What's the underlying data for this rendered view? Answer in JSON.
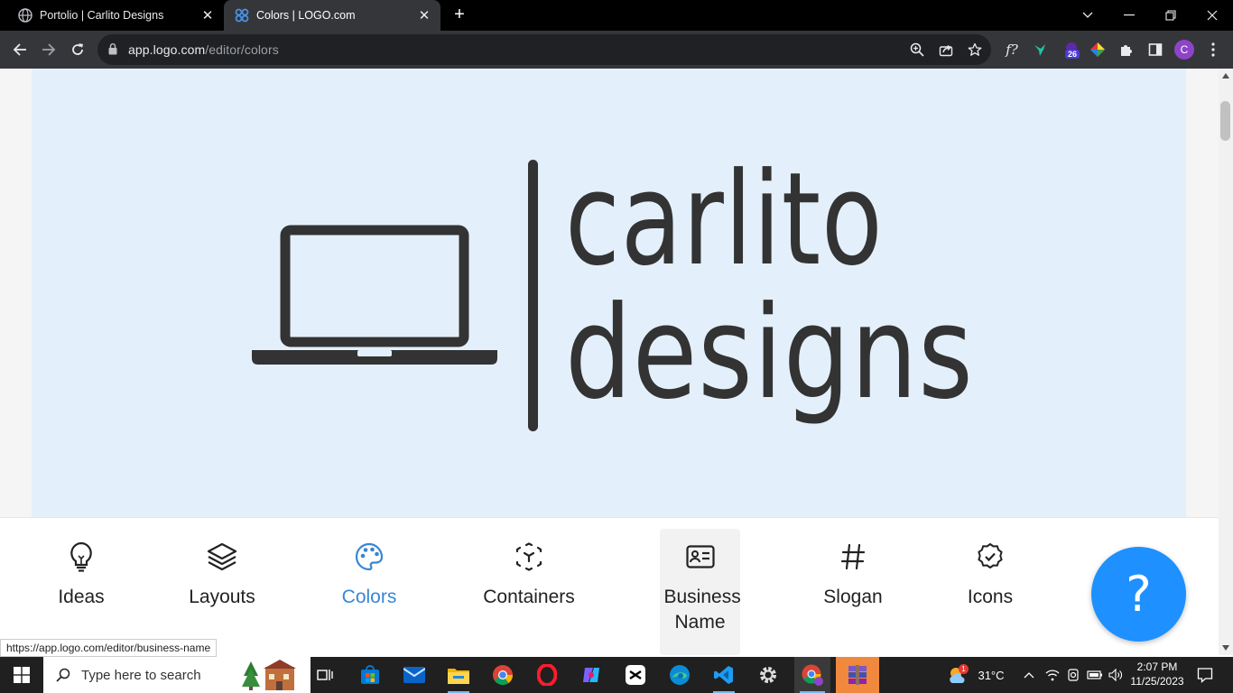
{
  "browser": {
    "tabs": [
      {
        "title": "Portolio | Carlito Designs"
      },
      {
        "title": "Colors | LOGO.com"
      }
    ],
    "url_host": "app.logo.com",
    "url_path": "/editor/colors"
  },
  "logo": {
    "line1": "carlito",
    "line2": "designs",
    "text_color": "#333333",
    "background": "#e3f0fb",
    "icon": "laptop-icon"
  },
  "tools": [
    {
      "label": "Ideas",
      "icon": "lightbulb-icon"
    },
    {
      "label": "Layouts",
      "icon": "layers-icon"
    },
    {
      "label": "Colors",
      "icon": "palette-icon",
      "active": true
    },
    {
      "label": "Containers",
      "icon": "container-icon"
    },
    {
      "label": "Business Name",
      "icon": "id-card-icon"
    },
    {
      "label": "Slogan",
      "icon": "hash-icon"
    },
    {
      "label": "Icons",
      "icon": "badge-check-icon"
    }
  ],
  "help_label": "?",
  "status_url": "https://app.logo.com/editor/business-name",
  "taskbar": {
    "search_placeholder": "Type here to search",
    "weather": "31°C",
    "weather_badge": "1",
    "time": "2:07 PM",
    "date": "11/25/2023"
  },
  "extensions": {
    "badge": "26",
    "profile": "C",
    "formula_icon": "f?"
  },
  "colors": {
    "accent": "#3a86d4",
    "help": "#1e90ff"
  }
}
